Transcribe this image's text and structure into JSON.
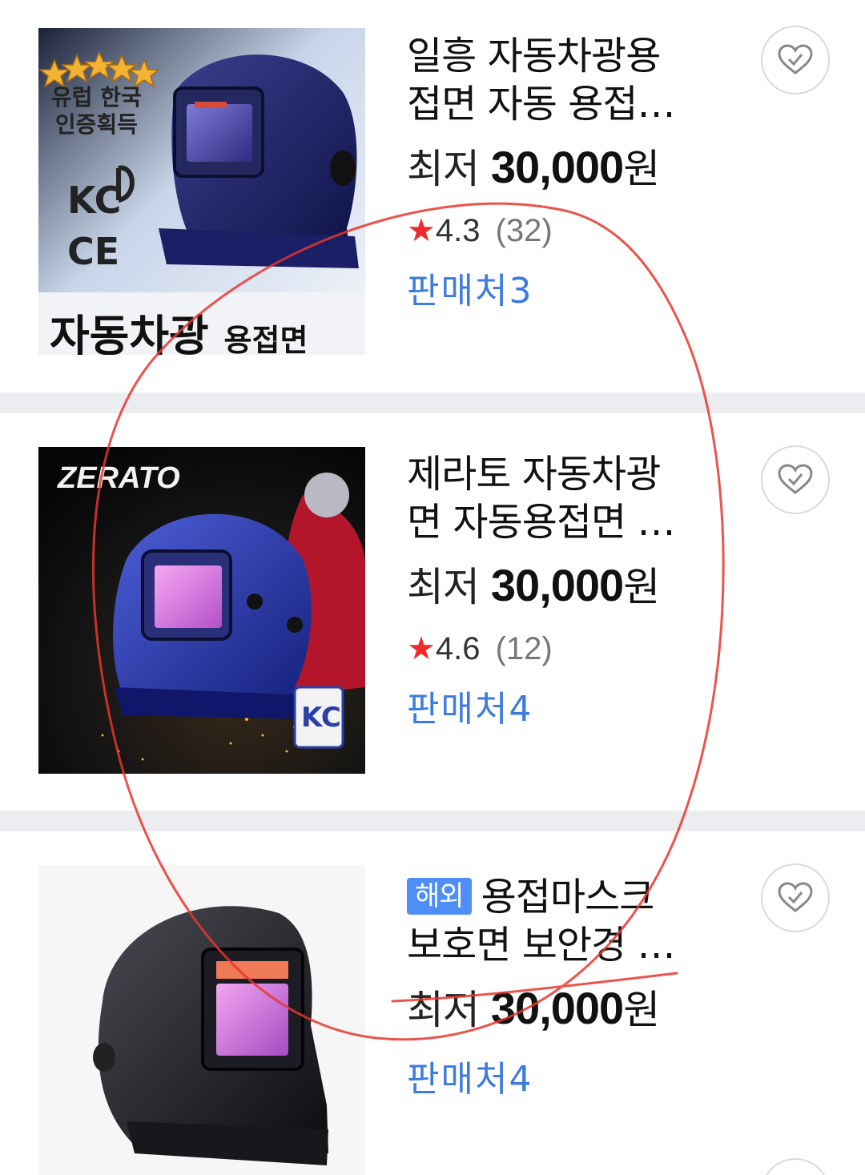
{
  "products": [
    {
      "title_lines": [
        "일흥 자동차광용",
        "접면 자동 용접…"
      ],
      "badge": "",
      "price_label": "최저",
      "price": "30,000",
      "price_unit": "원",
      "rating": "4.3",
      "review_count": "(32)",
      "sellers": "판매처3",
      "image_texts": [
        "유럽 한국",
        "인증획득",
        "CE",
        "자동차광",
        "용접면"
      ]
    },
    {
      "title_lines": [
        "제라토 자동차광",
        "면 자동용접면 …"
      ],
      "badge": "",
      "price_label": "최저",
      "price": "30,000",
      "price_unit": "원",
      "rating": "4.6",
      "review_count": "(12)",
      "sellers": "판매처4",
      "image_texts": [
        "ZERATO"
      ]
    },
    {
      "title_lines": [
        "용접마스크",
        "보호면 보안경 …"
      ],
      "badge": "해외",
      "price_label": "최저",
      "price": "30,000",
      "price_unit": "원",
      "rating": "",
      "review_count": "",
      "sellers": "판매처4",
      "image_texts": []
    }
  ],
  "icons": {
    "favorite": "heart-check-icon",
    "star": "star-icon"
  },
  "colors": {
    "star": "#ee2a2a",
    "sellers": "#3c7be0",
    "badge": "#4f8ef7",
    "divider": "#ebedf0",
    "annotation": "#e8352e"
  }
}
